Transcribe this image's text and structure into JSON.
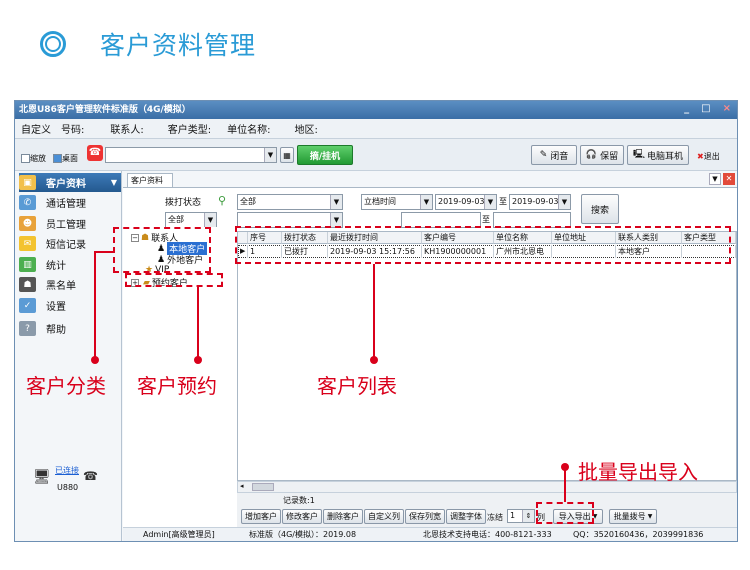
{
  "heading": {
    "title": "客户资料管理"
  },
  "window": {
    "title": "北恩U86客户管理软件标准版（4G/模拟）",
    "buttons": {
      "minimize": "_",
      "maximize": "□",
      "close": "×"
    }
  },
  "fields": [
    "自定义",
    "号码:",
    "联系人:",
    "客户类型:",
    "单位名称:",
    "地区:"
  ],
  "toolbar": {
    "zoom_label": "缩放",
    "desktop_label": "桌面",
    "dial_button": "摘/挂机",
    "mute_button": "闭音",
    "hold_button": "保留",
    "pc_headset_button": "电脑耳机",
    "exit_button": "退出"
  },
  "sidebar": {
    "items": [
      {
        "label": "客户资料",
        "active": true
      },
      {
        "label": "通话管理"
      },
      {
        "label": "员工管理"
      },
      {
        "label": "短信记录"
      },
      {
        "label": "统计"
      },
      {
        "label": "黑名单"
      },
      {
        "label": "设置"
      },
      {
        "label": "帮助"
      }
    ],
    "device_status": "已连接",
    "device_model": "U880"
  },
  "tab": {
    "label": "客户资料"
  },
  "filters": {
    "dial_status_label": "拨打状态",
    "dial_status_value": "全部",
    "all_value": "全部",
    "time_field": "立档时间",
    "date_from": "2019-09-03",
    "to_label": "至",
    "date_to": "2019-09-03",
    "to_label2": "至",
    "search_button": "搜索"
  },
  "tree": {
    "root": "联系人",
    "children": [
      "本地客户",
      "外地客户"
    ],
    "vip": "VIP",
    "appointment": "预约客户"
  },
  "table": {
    "columns": [
      "序号",
      "拨打状态",
      "最近拨打时间",
      "客户编号",
      "单位名称",
      "单位地址",
      "联系人类别",
      "客户类型"
    ],
    "rows": [
      [
        "1",
        "已拨打",
        "2019-09-03 15:17:56",
        "KH1900000001",
        "广州市北恩电",
        "",
        "本地客户",
        ""
      ]
    ]
  },
  "bottom": {
    "record_count": "记录数:1",
    "buttons": [
      "增加客户",
      "修改客户",
      "删除客户",
      "自定义列",
      "保存列宽",
      "调整字体"
    ],
    "freeze_label": "冻结",
    "freeze_value": "1",
    "col_label": "列",
    "import_export": "导入导出",
    "batch_dial": "批量拨号"
  },
  "statusbar": {
    "user": "Admin[高级管理员]",
    "version": "标准版（4G/模拟）：2019.08",
    "support": "北恩技术支持电话：400-8121-333",
    "qq": "QQ：3520160436，2039991836"
  },
  "annotations": {
    "category": "客户分类",
    "appointment": "客户预约",
    "list": "客户列表",
    "batch": "批量导出导入"
  },
  "colors": {
    "accent": "#2a9bd6",
    "annotation": "#d9001b",
    "titlebar": "#3a6ea6"
  }
}
